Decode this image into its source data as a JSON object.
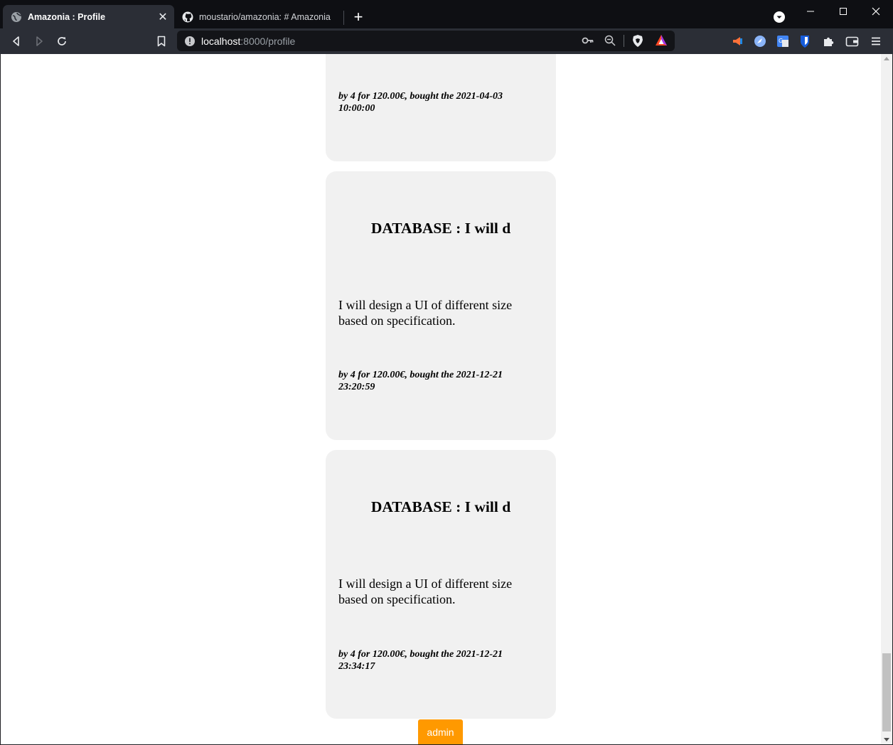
{
  "browser": {
    "tabs": [
      {
        "title": "Amazonia : Profile",
        "favicon": "globe-icon",
        "active": true
      },
      {
        "title": "moustario/amazonia: # Amazonia",
        "favicon": "github-icon",
        "active": false
      }
    ],
    "url_host": "localhost",
    "url_path": ":8000/profile"
  },
  "cards": [
    {
      "title": "",
      "description": "",
      "meta_line1": "by 4 for 120.00€, bought the 2021-04-03",
      "meta_line2": "10:00:00"
    },
    {
      "title": "DATABASE : I will d",
      "description": "I will design a UI of different size based on specification.",
      "meta_line1": "by 4 for 120.00€, bought the 2021-12-21",
      "meta_line2": "23:20:59"
    },
    {
      "title": "DATABASE : I will d",
      "description": "I will design a UI of different size based on specification.",
      "meta_line1": "by 4 for 120.00€, bought the 2021-12-21",
      "meta_line2": "23:34:17"
    }
  ],
  "admin_button": {
    "label": "admin",
    "color": "#ff9900"
  },
  "colors": {
    "card_bg": "#f1f1f1",
    "chrome_bg": "#0e0f13",
    "toolbar_bg": "#2b2e36"
  }
}
